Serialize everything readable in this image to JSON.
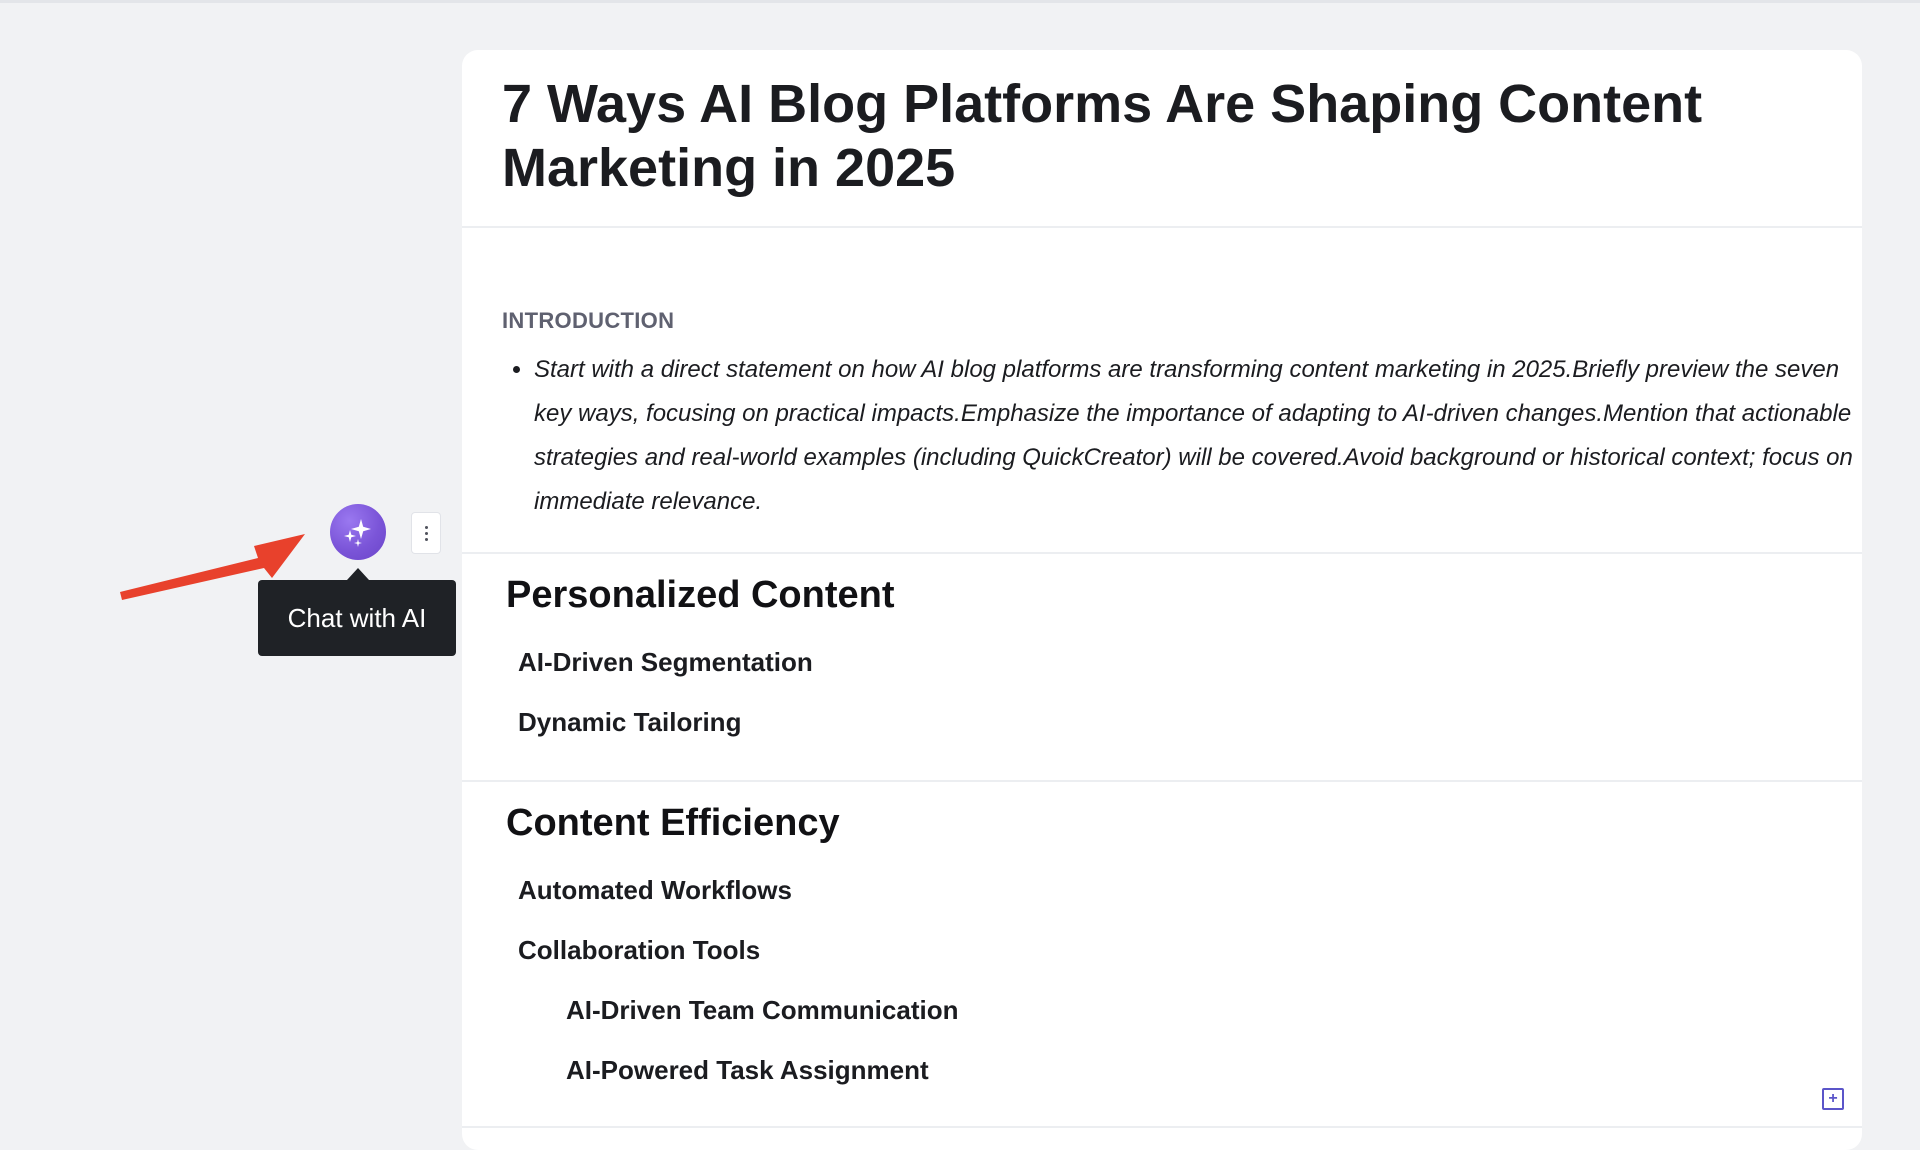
{
  "document": {
    "title": "7 Ways AI Blog Platforms Are Shaping Content Marketing in 2025",
    "introduction": {
      "heading": "INTRODUCTION",
      "bullet": "Start with a direct statement on how AI blog platforms are transforming content marketing in 2025.Briefly preview the seven key ways, focusing on practical impacts.Emphasize the importance of adapting to AI-driven changes.Mention that actionable strategies and real-world examples (including QuickCreator) will be covered.Avoid background or historical context; focus on immediate relevance."
    },
    "sections": [
      {
        "title": "Personalized Content",
        "items": [
          "AI-Driven Segmentation",
          "Dynamic Tailoring"
        ]
      },
      {
        "title": "Content Efficiency",
        "items": [
          "Automated Workflows",
          "Collaboration Tools"
        ],
        "subitems": [
          "AI-Driven Team Communication",
          "AI-Powered Task Assignment"
        ]
      }
    ]
  },
  "sidebar": {
    "ai_button_icon": "sparkles-icon",
    "more_icon": "vertical-ellipsis-icon",
    "tooltip": "Chat with AI"
  },
  "colors": {
    "ai_button": "#7b55d8",
    "tooltip_bg": "#1f2226",
    "annotation_arrow": "#e8412c",
    "page_bg": "#f1f2f4"
  }
}
